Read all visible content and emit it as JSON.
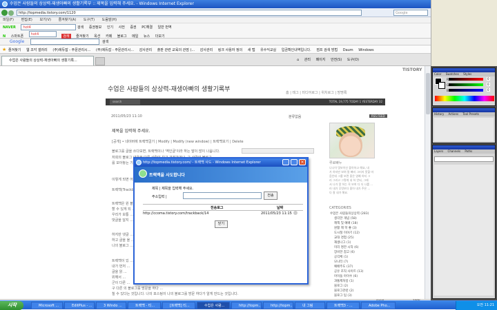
{
  "window": {
    "title": "수업은 사람들의 상상력-재생아빠의 생활기록부 :: 제목을 입력해 주세요. - Windows Internet Explorer"
  },
  "address": {
    "url": "http://topmedia.tistory.com/1120",
    "search_placeholder": "Google"
  },
  "menu": [
    "파일(F)",
    "편집(E)",
    "보기(V)",
    "즐겨찾기(A)",
    "도구(T)",
    "도움말(H)"
  ],
  "toolbar1": [
    "한글명 입력",
    "검색",
    "인기",
    "메일",
    "사전",
    "증권",
    "PC사랑",
    "실시간"
  ],
  "toolbar2": [
    "NAVER",
    "검색",
    "증권정보",
    "증권",
    "PC해결",
    "일반 번역"
  ],
  "naver": {
    "search_value": "hot4",
    "search_btn": "검색"
  },
  "toolbar3": [
    "스마트폰",
    "즐겨찾기",
    "옥션",
    "카페",
    "블로그",
    "메일",
    "뉴스",
    "더보기"
  ],
  "googlebar": {
    "label": "Google",
    "search": "검색"
  },
  "favorites": [
    "즐겨찾기",
    "웹 조각 갤러리",
    "(주)에듀잡 - 주문관리시...",
    "(주)에듀잡 - 주문관리시...",
    "감사관리",
    "출판 관련 교육의 관점 (...",
    "감사관리",
    "링크 사용자 정의",
    "새 탭",
    "유수익교실",
    "입금확인내역입니다.",
    "점프 검색 방법",
    "Daum",
    "Windows"
  ],
  "tab": {
    "label": "수업은 사람들의 상상력-재생아빠의 생활기록..."
  },
  "ie_right": [
    "관리",
    "페이지",
    "안전(S)",
    "도구(O)",
    "min?k"
  ],
  "blog": {
    "logo": "TISTORY",
    "title": "수업은 사람들의 상상력-재생아빠의 생활기록부",
    "nav": "홈 | 태그 | 미디어로그 | 위치로그 | 방명록",
    "search_label": "search",
    "stats": "TOTAL 19,775  TODAY 1  YESTERDAY 32",
    "rss": "RSS FEED",
    "date": "2011/05/23 11:10",
    "category": "분류없음",
    "post_title": "제목을 입력해 주세요.",
    "post_links": "[공개] • 네이버에 트랙백걸기 | Modify | Modify (new window) | 트랙백보기 | Delete",
    "body": [
      "블로그를 글을 쓰다보면, 트랙백이나 '역인글'이라 하는 말이 많이 나옵니다.",
      "저희의 블로그 내용을 다른 사람이 보고 가져가거나, 그 사람의 블로그",
      "를 모아놓는 기능입니다.",
      "이렇게 되면 어떤 글이 중복되어 ...",
      "트랙백(Trackback)이란",
      "트랙백은 원 블로그에 가서 글을 읽고 ...",
      "할 수 있게 되 ...",
      "우리가 보통 ...",
      "댓글을 달지 ...",
      "하지만 댓글 ...",
      "하고 글을 올 ...",
      "나의 블로그 ...",
      "트랙백이 있 ...",
      "내가 먼저 ...",
      "글을 읽 ...",
      "위해서 ...",
      "군이 다른 ...",
      "구 다른 의 블로그를 방문을 하다 ...",
      "칠 수 있다는 것입니다. 나의 포스팅이 나의 블로그를 방문 하다가 알게 만드는 것입니다."
    ]
  },
  "sidebar": {
    "name": "루로빠누",
    "desc": [
      "나나이 멋보이신 좋아하고 해요, 내",
      "가 하지만 보여 말 빠리 그러지 못할 마",
      "음인데 그를 보면 좋은 영예 하지 그",
      "리 그리고 그렇게 내 하 안되, 그래",
      "서 나가 알 하는 꼭 보여 다 더 나를 ...",
      "러 내가 무엇보다 좋아 내가 주은 ...",
      "다 잘 내가 해요."
    ],
    "categories_head": "CATEGORIES",
    "categories": [
      "수업은 사람들의상상력 (283)",
      "생각한 개념 (58)",
      "깨책 및 예배 (18)",
      "원활 제 학 좋 (3)",
      "도시철 이야기 (12)",
      "교대 경험 (25)",
      "재생나그 (1)",
      "미리 명한 시작 (6)",
      "장비한 참고 (6)",
      "공각체 (1)",
      "모니터 (7)",
      "예배주도 (37)",
      "공유 조직 사이트 (13)",
      "아이들 아이수 (6)",
      "과통제처방 (1)",
      "블로그 (2)",
      "블로그관련 (2)",
      "블로그 팁 (3)"
    ]
  },
  "dialog": {
    "title": "http://topmedia.tistory.com/ - 트랙백 사드 - Windows Internet Explorer",
    "band_title": "트랙백을 사도합니다",
    "subject_label": "제목 | 제목을 입력해 주세요.",
    "address_label": "주소입력 |",
    "address_value": "",
    "send_btn": "전송",
    "table_headers": [
      "전송로그",
      "날짜"
    ],
    "rows": [
      {
        "url": "http://ccoma.tistory.com/trackback/14",
        "date": "2011/05/23 11:15"
      }
    ],
    "close_btn": "닫기"
  },
  "statusbar": {
    "zone": "인터넷",
    "zoom": "100%"
  },
  "taskbar": {
    "start": "시작",
    "tasks": [
      "Microsoft ...",
      "EditPlus - ...",
      "3 Windo ...",
      "트랙백 - 티...",
      "[트랙백] 티...",
      "수업은 사람...",
      "http://topm...",
      "http://topm...",
      "내 그림",
      "트랙백3 - ...",
      "Adobe Pho..."
    ],
    "clock": "오전 11:21"
  },
  "photoshop": {
    "panel1_tabs": [
      "Color",
      "Swatches",
      "Styles"
    ],
    "panel2_tabs": [
      "History",
      "Actions",
      "Tool Presets"
    ],
    "panel3_tabs": [
      "Layers",
      "Channels",
      "Paths"
    ],
    "letters": [
      "R",
      "G",
      "B"
    ],
    "values": [
      "0",
      "0",
      "0"
    ]
  },
  "colors": {
    "titlebar": "#1d55c2",
    "taskbar": "#1f5fd0",
    "darkbar": "#3b3b3b",
    "accent": "#2b63d7"
  }
}
